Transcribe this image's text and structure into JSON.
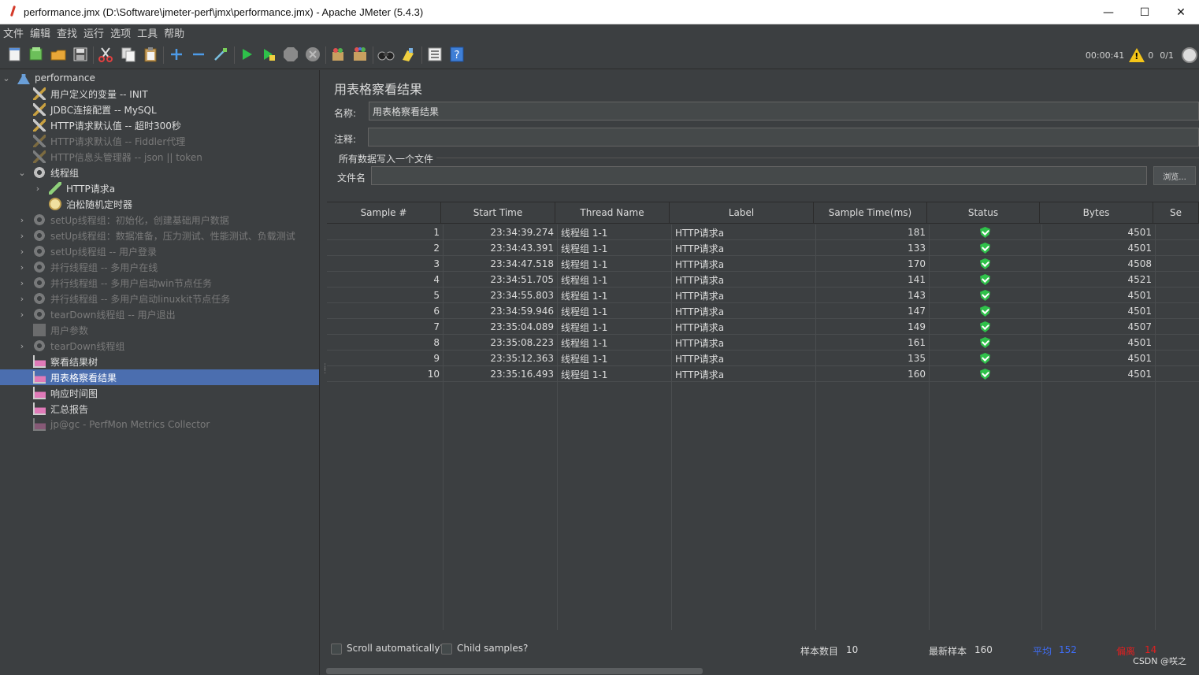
{
  "window": {
    "title": "performance.jmx (D:\\Software\\jmeter-perf\\jmx\\performance.jmx) - Apache JMeter (5.4.3)",
    "minimize": "—",
    "maximize": "☐",
    "close": "✕"
  },
  "menu": [
    "文件",
    "编辑",
    "查找",
    "运行",
    "选项",
    "工具",
    "帮助"
  ],
  "toolbar": {
    "timer": "00:00:41",
    "warnings": "0",
    "threads": "0/1"
  },
  "tree": [
    {
      "label": "performance",
      "icon": "flask-icon",
      "level": 0,
      "arrow": "v",
      "state": "enabled"
    },
    {
      "label": "用户定义的变量 -- INIT",
      "icon": "wrench-icon",
      "level": 1,
      "arrow": "",
      "state": "enabled"
    },
    {
      "label": "JDBC连接配置 -- MySQL",
      "icon": "wrench-icon",
      "level": 1,
      "arrow": "",
      "state": "enabled"
    },
    {
      "label": "HTTP请求默认值 -- 超时300秒",
      "icon": "wrench-icon",
      "level": 1,
      "arrow": "",
      "state": "enabled"
    },
    {
      "label": "HTTP请求默认值 -- Fiddler代理",
      "icon": "wrench-icon",
      "level": 1,
      "arrow": "",
      "state": "disabled"
    },
    {
      "label": "HTTP信息头管理器 -- json || token",
      "icon": "wrench-icon",
      "level": 1,
      "arrow": "",
      "state": "disabled"
    },
    {
      "label": "线程组",
      "icon": "gear-icon",
      "level": 1,
      "arrow": "v",
      "state": "enabled"
    },
    {
      "label": "HTTP请求a",
      "icon": "pen-icon",
      "level": 2,
      "arrow": ">",
      "state": "enabled"
    },
    {
      "label": "泊松随机定时器",
      "icon": "clock-icon",
      "level": 2,
      "arrow": "",
      "state": "enabled"
    },
    {
      "label": "setUp线程组：初始化，创建基础用户数据",
      "icon": "gear-icon",
      "level": 1,
      "arrow": ">",
      "state": "disabled"
    },
    {
      "label": "setUp线程组：数据准备，压力测试、性能测试、负载测试",
      "icon": "gear-icon",
      "level": 1,
      "arrow": ">",
      "state": "disabled"
    },
    {
      "label": "setUp线程组 -- 用户登录",
      "icon": "gear-icon",
      "level": 1,
      "arrow": ">",
      "state": "disabled"
    },
    {
      "label": "并行线程组 -- 多用户在线",
      "icon": "gear-icon",
      "level": 1,
      "arrow": ">",
      "state": "disabled"
    },
    {
      "label": "并行线程组 -- 多用户启动win节点任务",
      "icon": "gear-icon",
      "level": 1,
      "arrow": ">",
      "state": "disabled"
    },
    {
      "label": "并行线程组 -- 多用户启动linuxkit节点任务",
      "icon": "gear-icon",
      "level": 1,
      "arrow": ">",
      "state": "disabled"
    },
    {
      "label": "tearDown线程组 -- 用户退出",
      "icon": "gear-icon",
      "level": 1,
      "arrow": ">",
      "state": "disabled"
    },
    {
      "label": "用户参数",
      "icon": "doc-icon",
      "level": 1,
      "arrow": "",
      "state": "disabled"
    },
    {
      "label": "tearDown线程组",
      "icon": "gear-icon",
      "level": 1,
      "arrow": ">",
      "state": "disabled"
    },
    {
      "label": "察看结果树",
      "icon": "chart-icon",
      "level": 1,
      "arrow": "",
      "state": "enabled"
    },
    {
      "label": "用表格察看结果",
      "icon": "chart-icon",
      "level": 1,
      "arrow": "",
      "state": "selected"
    },
    {
      "label": "响应时间图",
      "icon": "chart-icon",
      "level": 1,
      "arrow": "",
      "state": "enabled"
    },
    {
      "label": "汇总报告",
      "icon": "chart-icon",
      "level": 1,
      "arrow": "",
      "state": "enabled"
    },
    {
      "label": "jp@gc - PerfMon Metrics Collector",
      "icon": "chart-icon",
      "level": 1,
      "arrow": "",
      "state": "disabled"
    }
  ],
  "panel": {
    "title": "用表格察看结果",
    "name_label": "名称:",
    "name_value": "用表格察看结果",
    "comment_label": "注释:",
    "comment_value": "",
    "group_legend": "所有数据写入一个文件",
    "filename_label": "文件名",
    "filename_value": "",
    "browse_label": "浏览..."
  },
  "table": {
    "columns": [
      "Sample #",
      "Start Time",
      "Thread Name",
      "Label",
      "Sample Time(ms)",
      "Status",
      "Bytes",
      "Se"
    ],
    "rows": [
      {
        "sample": "1",
        "start": "23:34:39.274",
        "thread": "线程组 1-1",
        "label": "HTTP请求a",
        "time": "181",
        "status": "ok",
        "bytes": "4501"
      },
      {
        "sample": "2",
        "start": "23:34:43.391",
        "thread": "线程组 1-1",
        "label": "HTTP请求a",
        "time": "133",
        "status": "ok",
        "bytes": "4501"
      },
      {
        "sample": "3",
        "start": "23:34:47.518",
        "thread": "线程组 1-1",
        "label": "HTTP请求a",
        "time": "170",
        "status": "ok",
        "bytes": "4508"
      },
      {
        "sample": "4",
        "start": "23:34:51.705",
        "thread": "线程组 1-1",
        "label": "HTTP请求a",
        "time": "141",
        "status": "ok",
        "bytes": "4521"
      },
      {
        "sample": "5",
        "start": "23:34:55.803",
        "thread": "线程组 1-1",
        "label": "HTTP请求a",
        "time": "143",
        "status": "ok",
        "bytes": "4501"
      },
      {
        "sample": "6",
        "start": "23:34:59.946",
        "thread": "线程组 1-1",
        "label": "HTTP请求a",
        "time": "147",
        "status": "ok",
        "bytes": "4501"
      },
      {
        "sample": "7",
        "start": "23:35:04.089",
        "thread": "线程组 1-1",
        "label": "HTTP请求a",
        "time": "149",
        "status": "ok",
        "bytes": "4507"
      },
      {
        "sample": "8",
        "start": "23:35:08.223",
        "thread": "线程组 1-1",
        "label": "HTTP请求a",
        "time": "161",
        "status": "ok",
        "bytes": "4501"
      },
      {
        "sample": "9",
        "start": "23:35:12.363",
        "thread": "线程组 1-1",
        "label": "HTTP请求a",
        "time": "135",
        "status": "ok",
        "bytes": "4501"
      },
      {
        "sample": "10",
        "start": "23:35:16.493",
        "thread": "线程组 1-1",
        "label": "HTTP请求a",
        "time": "160",
        "status": "ok",
        "bytes": "4501"
      }
    ]
  },
  "footer": {
    "scroll_auto": "Scroll automatically?",
    "child_samples": "Child samples?",
    "sample_count_label": "样本数目",
    "sample_count": "10",
    "latest_label": "最新样本",
    "latest": "160",
    "avg_label": "平均",
    "avg": "152",
    "dev_label": "偏离",
    "dev": "14",
    "avg_color": "#3f6df5",
    "dev_color": "#e02020"
  },
  "watermark": "CSDN @咲之"
}
